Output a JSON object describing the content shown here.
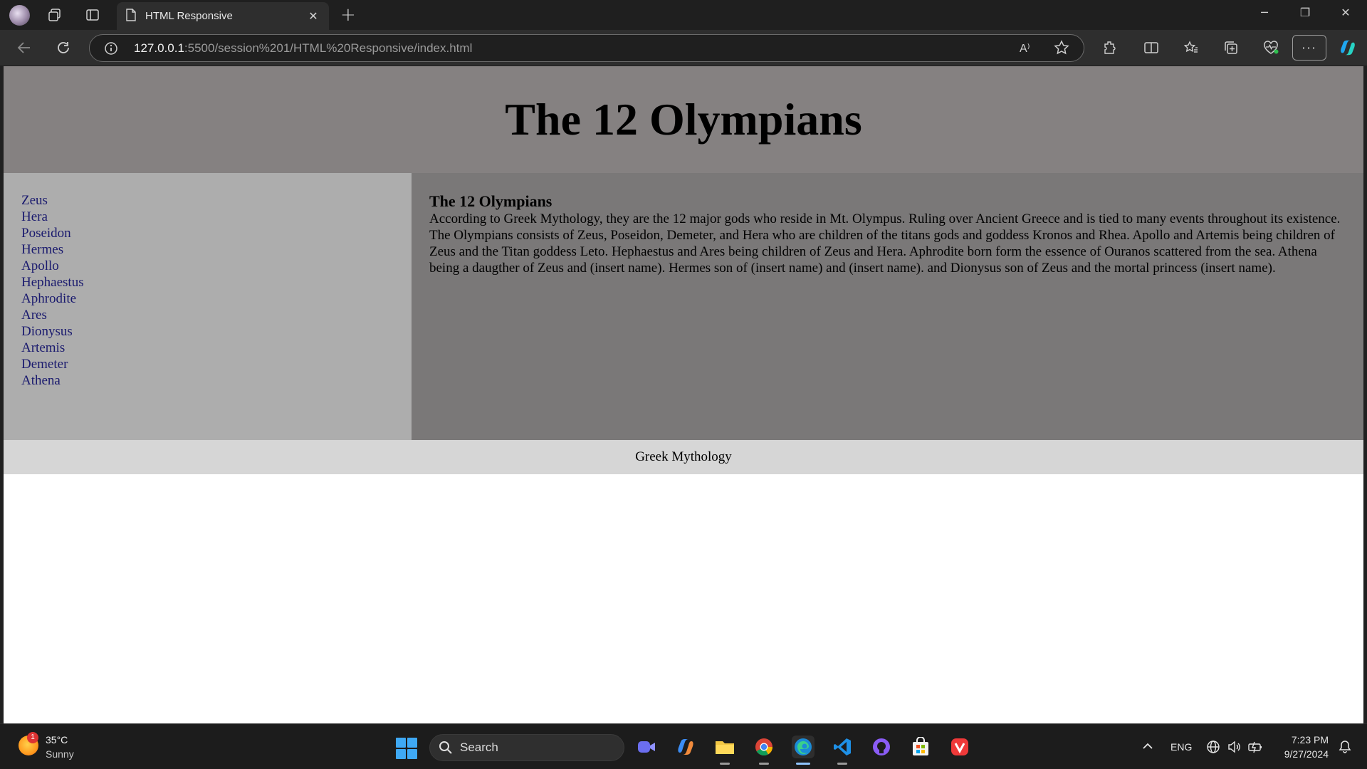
{
  "browser": {
    "tab_title": "HTML Responsive",
    "url_host": "127.0.0.1",
    "url_rest": ":5500/session%201/HTML%20Responsive/index.html"
  },
  "page": {
    "title": "The 12 Olympians",
    "sidebar_links": [
      "Zeus",
      "Hera",
      "Poseidon",
      "Hermes",
      "Apollo",
      "Hephaestus",
      "Aphrodite",
      "Ares",
      "Dionysus",
      "Artemis",
      "Demeter",
      "Athena"
    ],
    "content_heading": "The 12 Olympians",
    "paragraph_1": "According to Greek Mythology, they are the 12 major gods who reside in Mt. Olympus. Ruling over Ancient Greece and is tied to many events throughout its existence.",
    "paragraph_2": "The Olympians consists of Zeus, Poseidon, Demeter, and Hera who are children of the titans gods and goddess Kronos and Rhea. Apollo and Artemis being children of Zeus and the Titan goddess Leto. Hephaestus and Ares being children of Zeus and Hera. Aphrodite born form the essence of Ouranos scattered from the sea. Athena being a daugther of Zeus and (insert name). Hermes son of (insert name) and (insert name). and Dionysus son of Zeus and the mortal princess (insert name).",
    "footer": "Greek Mythology"
  },
  "taskbar": {
    "weather_temp": "35°C",
    "weather_condition": "Sunny",
    "weather_badge": "1",
    "search_label": "Search",
    "language": "ENG",
    "time": "7:23 PM",
    "date": "9/27/2024"
  },
  "colors": {
    "header_bg": "#858181",
    "sidebar_bg": "#adadad",
    "content_bg": "#7a7878",
    "footer_bg": "#d6d6d6",
    "link": "#1a1a6e"
  }
}
